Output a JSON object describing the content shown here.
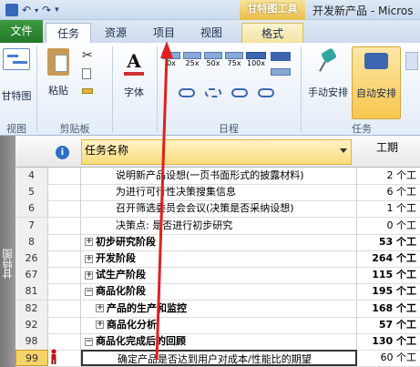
{
  "window": {
    "title": "开发新产品 - Micros",
    "context_tool": "甘特图工具"
  },
  "tabs": [
    {
      "label": "文件"
    },
    {
      "label": "任务"
    },
    {
      "label": "资源"
    },
    {
      "label": "项目"
    },
    {
      "label": "视图"
    },
    {
      "label": "格式"
    }
  ],
  "ribbon": {
    "view_btn": "甘特图",
    "paste_btn": "粘贴",
    "font_btn": "字体",
    "manual_btn": "手动安排",
    "auto_btn": "自动安排",
    "pct_labels": [
      "0x",
      "25x",
      "50x",
      "75x",
      "100x"
    ],
    "groups": {
      "view": "视图",
      "clipboard": "剪贴板",
      "schedule": "日程",
      "tasks": "任务"
    }
  },
  "sidebar": {
    "label": "甘特图"
  },
  "table": {
    "col_name": "任务名称",
    "col_dur": "工期",
    "rows": [
      {
        "id": "4",
        "name": "说明新产品设想(一页书面形式的披露材料)",
        "dur": "2 个工",
        "level": 3,
        "bold": false,
        "toggle": ""
      },
      {
        "id": "5",
        "name": "为进行可行性决策搜集信息",
        "dur": "6 个工",
        "level": 3,
        "bold": false,
        "toggle": ""
      },
      {
        "id": "6",
        "name": "召开筛选委员会会议(决策是否采纳设想)",
        "dur": "1 个工",
        "level": 3,
        "bold": false,
        "toggle": ""
      },
      {
        "id": "7",
        "name": "决策点: 是否进行初步研究",
        "dur": "0 个工",
        "level": 3,
        "bold": false,
        "toggle": ""
      },
      {
        "id": "8",
        "name": "初步研究阶段",
        "dur": "53 个工",
        "level": 1,
        "bold": true,
        "toggle": "+"
      },
      {
        "id": "26",
        "name": "开发阶段",
        "dur": "264 个工",
        "level": 1,
        "bold": true,
        "toggle": "+"
      },
      {
        "id": "67",
        "name": "试生产阶段",
        "dur": "115 个工",
        "level": 1,
        "bold": true,
        "toggle": "+"
      },
      {
        "id": "81",
        "name": "商品化阶段",
        "dur": "195 个工",
        "level": 1,
        "bold": true,
        "toggle": "−"
      },
      {
        "id": "82",
        "name": "产品的生产和监控",
        "dur": "168 个工",
        "level": 2,
        "bold": true,
        "toggle": "+"
      },
      {
        "id": "92",
        "name": "商品化分析",
        "dur": "57 个工",
        "level": 2,
        "bold": true,
        "toggle": "+"
      },
      {
        "id": "98",
        "name": "商品化完成后的回顾",
        "dur": "130 个工",
        "level": 1,
        "bold": true,
        "toggle": "−"
      },
      {
        "id": "99",
        "name": "确定产品是否达到用户对成本/性能比的期望",
        "dur": "60 个工",
        "level": 3,
        "bold": false,
        "toggle": "",
        "selected": true
      }
    ]
  },
  "colors": {
    "file_tab": "#2e8b35",
    "accent_red": "#e02020",
    "selected_cell": "#f6d26a"
  }
}
